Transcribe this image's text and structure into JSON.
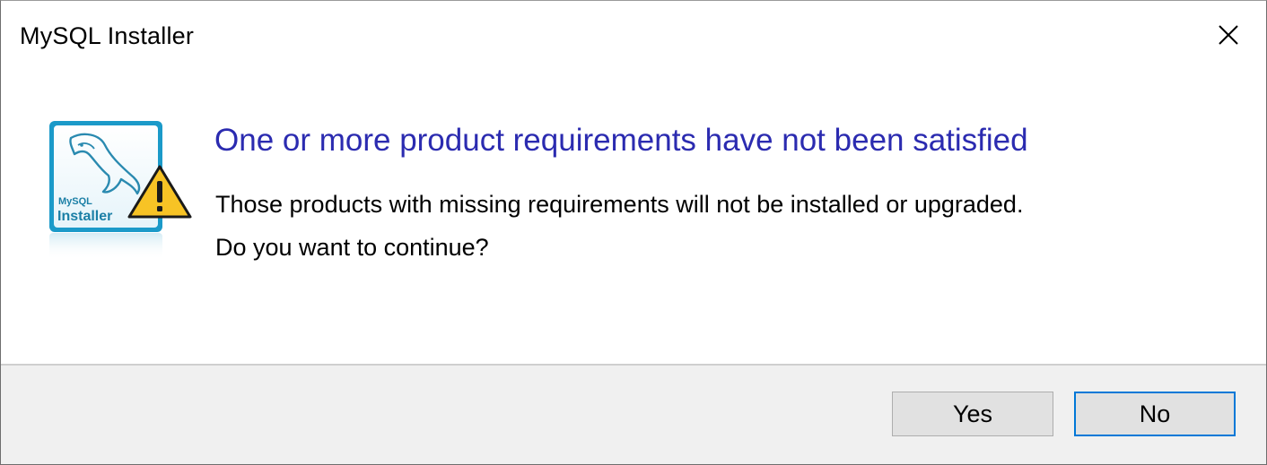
{
  "window": {
    "title": "MySQL Installer"
  },
  "dialog": {
    "icon": {
      "name": "mysql-installer-warning-icon",
      "logo_text_line1": "MySQL",
      "logo_text_line2": "Installer"
    },
    "heading": "One or more product requirements have not been satisfied",
    "message_line1": "Those products with missing requirements will not be installed or upgraded.",
    "message_line2": "Do you want to continue?"
  },
  "buttons": {
    "yes_label": "Yes",
    "no_label": "No",
    "default": "No"
  },
  "colors": {
    "heading": "#2b2bb0",
    "default_button_border": "#0078d7",
    "footer_background": "#f0f0f0",
    "warning_yellow": "#f7c325"
  }
}
